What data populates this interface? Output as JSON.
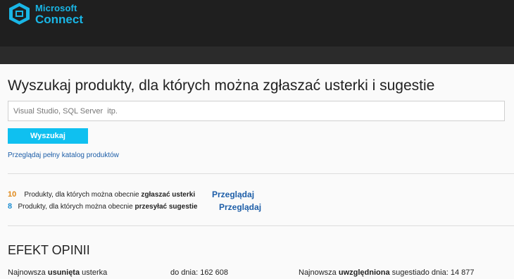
{
  "header": {
    "brand_line1": "Microsoft",
    "brand_line2": "Connect",
    "logo_icon": "connect-logo-icon",
    "brand_color": "#19b6e6",
    "bar_color": "#1f1f1f"
  },
  "search": {
    "heading": "Wyszukaj produkty, dla których można zgłaszać usterki i sugestie",
    "placeholder": "Visual Studio, SQL Server  itp.",
    "value": "",
    "button_label": "Wyszukaj",
    "button_color": "#0fc0f0",
    "catalog_link": "Przeglądaj pełny katalog produktów"
  },
  "stats": [
    {
      "count": "10",
      "prefix": "Produkty, dla których można obecnie ",
      "emphasis": "zgłaszać usterki",
      "link": "Przeglądaj",
      "count_color": "#e0891a"
    },
    {
      "count": "8",
      "prefix": "Produkty, dla których można obecnie ",
      "emphasis": "przesyłać sugestie",
      "link": "Przeglądaj",
      "count_color": "#1d8ed2"
    }
  ],
  "feedback": {
    "title": "EFEKT OPINII",
    "fixed_prefix": "Najnowsza ",
    "fixed_emphasis": "usunięta",
    "fixed_suffix": " usterka",
    "fixed_value": "do dnia: 162 608",
    "considered_prefix": "Najnowsza ",
    "considered_emphasis": "uwzględniona",
    "considered_suffix": " sugestiado dnia: 14 877"
  }
}
